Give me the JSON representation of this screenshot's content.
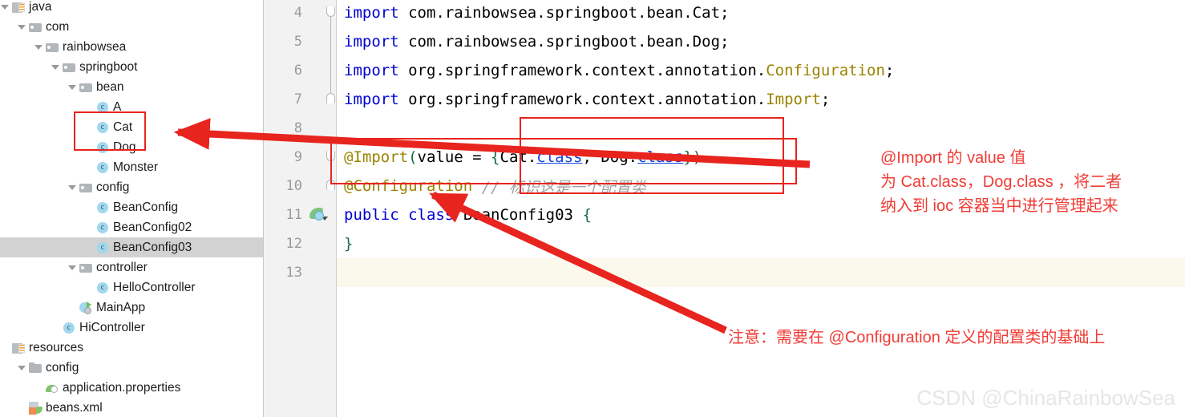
{
  "colors": {
    "annotation_red": "#e8241e",
    "annotation_text_red": "#f03c36",
    "selection_gray": "#d2d2d2",
    "gutter_bg": "#f2f2f2",
    "line_highlight": "#fbf8ec",
    "keyword_blue": "#0000d0",
    "annotation_olive": "#9a8300",
    "comment_gray": "#a0a0a0",
    "watermark_gray": "#e6e6e6"
  },
  "project_tree": {
    "items": [
      {
        "label": "java",
        "icon": "resources-icon",
        "indent": 0,
        "arrow": "open",
        "selected": false
      },
      {
        "label": "com",
        "icon": "folder-icon",
        "indent": 1,
        "arrow": "open",
        "selected": false
      },
      {
        "label": "rainbowsea",
        "icon": "folder-icon",
        "indent": 2,
        "arrow": "open",
        "selected": false
      },
      {
        "label": "springboot",
        "icon": "folder-icon",
        "indent": 3,
        "arrow": "open",
        "selected": false
      },
      {
        "label": "bean",
        "icon": "folder-icon",
        "indent": 4,
        "arrow": "open",
        "selected": false
      },
      {
        "label": "A",
        "icon": "class-icon",
        "indent": 5,
        "arrow": "none",
        "selected": false
      },
      {
        "label": "Cat",
        "icon": "class-icon",
        "indent": 5,
        "arrow": "none",
        "selected": false
      },
      {
        "label": "Dog",
        "icon": "class-icon",
        "indent": 5,
        "arrow": "none",
        "selected": false
      },
      {
        "label": "Monster",
        "icon": "class-icon",
        "indent": 5,
        "arrow": "none",
        "selected": false
      },
      {
        "label": "config",
        "icon": "folder-icon",
        "indent": 4,
        "arrow": "open",
        "selected": false
      },
      {
        "label": "BeanConfig",
        "icon": "class-icon",
        "indent": 5,
        "arrow": "none",
        "selected": false
      },
      {
        "label": "BeanConfig02",
        "icon": "class-icon",
        "indent": 5,
        "arrow": "none",
        "selected": false
      },
      {
        "label": "BeanConfig03",
        "icon": "class-icon",
        "indent": 5,
        "arrow": "none",
        "selected": true
      },
      {
        "label": "controller",
        "icon": "folder-icon",
        "indent": 4,
        "arrow": "open",
        "selected": false
      },
      {
        "label": "HelloController",
        "icon": "class-icon",
        "indent": 5,
        "arrow": "none",
        "selected": false
      },
      {
        "label": "MainApp",
        "icon": "main-class-icon",
        "indent": 4,
        "arrow": "none",
        "selected": false
      },
      {
        "label": "HiController",
        "icon": "class-icon",
        "indent": 3,
        "arrow": "none",
        "selected": false
      },
      {
        "label": "resources",
        "icon": "resources-icon",
        "indent": 0,
        "arrow": "none",
        "selected": false
      },
      {
        "label": "config",
        "icon": "folder-plain-icon",
        "indent": 1,
        "arrow": "open",
        "selected": false
      },
      {
        "label": "application.properties",
        "icon": "properties-icon",
        "indent": 2,
        "arrow": "none",
        "selected": false
      },
      {
        "label": "beans.xml",
        "icon": "xml-spring-icon",
        "indent": 1,
        "arrow": "none",
        "selected": false
      }
    ]
  },
  "editor": {
    "lines": [
      {
        "number": "4",
        "fold": "start",
        "gutter_icon": "none",
        "highlight": false,
        "tokens": [
          {
            "text": "import ",
            "style": "kw"
          },
          {
            "text": "com.rainbowsea.springboot.bean.Cat;",
            "style": "plain"
          }
        ]
      },
      {
        "number": "5",
        "fold": "mid",
        "gutter_icon": "none",
        "highlight": false,
        "tokens": [
          {
            "text": "import ",
            "style": "kw"
          },
          {
            "text": "com.rainbowsea.springboot.bean.Dog;",
            "style": "plain"
          }
        ]
      },
      {
        "number": "6",
        "fold": "mid",
        "gutter_icon": "none",
        "highlight": false,
        "tokens": [
          {
            "text": "import ",
            "style": "kw"
          },
          {
            "text": "org.springframework.context.annotation.",
            "style": "plain"
          },
          {
            "text": "Configuration",
            "style": "anno"
          },
          {
            "text": ";",
            "style": "plain"
          }
        ]
      },
      {
        "number": "7",
        "fold": "end",
        "gutter_icon": "none",
        "highlight": false,
        "tokens": [
          {
            "text": "import ",
            "style": "kw"
          },
          {
            "text": "org.springframework.context.annotation.",
            "style": "plain"
          },
          {
            "text": "Import",
            "style": "anno"
          },
          {
            "text": ";",
            "style": "plain"
          }
        ]
      },
      {
        "number": "8",
        "fold": "none",
        "gutter_icon": "none",
        "highlight": false,
        "tokens": []
      },
      {
        "number": "9",
        "fold": "start",
        "gutter_icon": "none",
        "highlight": false,
        "tokens": [
          {
            "text": "@Import",
            "style": "anno"
          },
          {
            "text": "(",
            "style": "punct"
          },
          {
            "text": "value = ",
            "style": "plain"
          },
          {
            "text": "{",
            "style": "punct"
          },
          {
            "text": "Cat.",
            "style": "plain"
          },
          {
            "text": "class",
            "style": "classkw"
          },
          {
            "text": ", Dog.",
            "style": "plain"
          },
          {
            "text": "class",
            "style": "classkw"
          },
          {
            "text": "}",
            "style": "punct"
          },
          {
            "text": ")",
            "style": "punct"
          }
        ]
      },
      {
        "number": "10",
        "fold": "end",
        "gutter_icon": "none",
        "highlight": false,
        "tokens": [
          {
            "text": "@Configuration",
            "style": "anno"
          },
          {
            "text": " ",
            "style": "plain"
          },
          {
            "text": "// 标识这是一个配置类",
            "style": "comment"
          }
        ]
      },
      {
        "number": "11",
        "fold": "none",
        "gutter_icon": "spring-bean-icon",
        "highlight": false,
        "tokens": [
          {
            "text": "public ",
            "style": "kw"
          },
          {
            "text": "class ",
            "style": "kw"
          },
          {
            "text": "BeanConfig03 ",
            "style": "plain"
          },
          {
            "text": "{",
            "style": "punct"
          }
        ]
      },
      {
        "number": "12",
        "fold": "none",
        "gutter_icon": "none",
        "highlight": false,
        "tokens": [
          {
            "text": "}",
            "style": "punct"
          }
        ]
      },
      {
        "number": "13",
        "fold": "none",
        "gutter_icon": "none",
        "highlight": true,
        "tokens": []
      }
    ]
  },
  "annotations": {
    "note_import": "@Import 的 value 值\n为 Cat.class，Dog.class ，将二者\n纳入到 ioc 容器当中进行管理起来",
    "note_configuration": "注意：需要在 @Configuration 定义的配置类的基础上"
  },
  "watermark": {
    "text": "CSDN @ChinaRainbowSea"
  }
}
